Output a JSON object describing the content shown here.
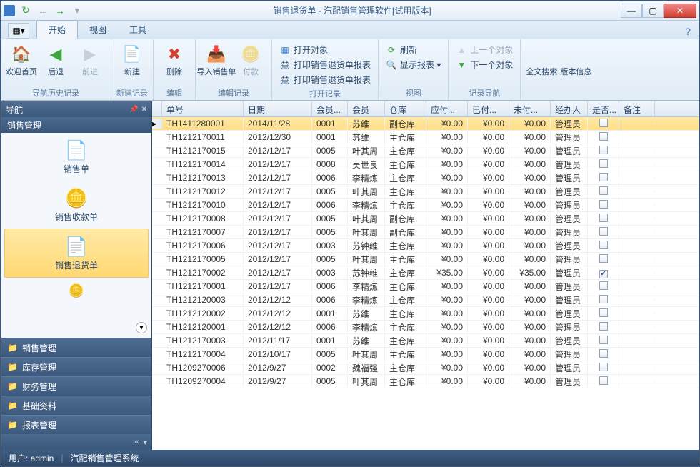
{
  "window": {
    "title": "销售退货单 - 汽配销售管理软件[试用版本]"
  },
  "qat": {
    "refresh": "↻",
    "back": "←",
    "fwd": "→",
    "dd": "▾"
  },
  "tabs": {
    "file": "▦▾",
    "start": "开始",
    "view": "视图",
    "tools": "工具"
  },
  "ribbon": {
    "g1": {
      "label": "导航历史记录",
      "home": "欢迎首页",
      "back": "后退",
      "fwd": "前进"
    },
    "g2": {
      "label": "新建记录",
      "new": "新建"
    },
    "g3": {
      "label": "编辑",
      "del": "删除"
    },
    "g4": {
      "label": "编辑记录",
      "import": "导入销售单",
      "pay": "付款"
    },
    "g5": {
      "label": "打开记录",
      "open": "打开对象",
      "print1": "打印销售退货单报表",
      "print2": "打印销售退货单报表"
    },
    "g6": {
      "label": "视图",
      "refresh": "刷新",
      "show": "显示报表 ▾"
    },
    "g7": {
      "label": "记录导航",
      "prev": "上一个对象",
      "next": "下一个对象"
    },
    "g8": {
      "search": "全文搜索",
      "ver": "版本信息"
    }
  },
  "nav": {
    "title": "导航",
    "section": "销售管理",
    "items": [
      {
        "label": "销售单"
      },
      {
        "label": "销售收款单"
      },
      {
        "label": "销售退货单"
      }
    ],
    "cats": [
      "销售管理",
      "库存管理",
      "财务管理",
      "基础资料",
      "报表管理"
    ]
  },
  "grid": {
    "cols": [
      "单号",
      "日期",
      "会员...",
      "会员",
      "仓库",
      "应付...",
      "已付...",
      "未付...",
      "经办人",
      "是否...",
      "备注"
    ],
    "rows": [
      {
        "no": "TH1411280001",
        "date": "2014/11/28",
        "mid": "0001",
        "mem": "苏维",
        "wh": "副仓库",
        "due": "¥0.00",
        "paid": "¥0.00",
        "un": "¥0.00",
        "op": "管理员",
        "chk": false,
        "sel": true
      },
      {
        "no": "TH1212170011",
        "date": "2012/12/30",
        "mid": "0001",
        "mem": "苏维",
        "wh": "主仓库",
        "due": "¥0.00",
        "paid": "¥0.00",
        "un": "¥0.00",
        "op": "管理员",
        "chk": false
      },
      {
        "no": "TH1212170015",
        "date": "2012/12/17",
        "mid": "0005",
        "mem": "叶其周",
        "wh": "主仓库",
        "due": "¥0.00",
        "paid": "¥0.00",
        "un": "¥0.00",
        "op": "管理员",
        "chk": false
      },
      {
        "no": "TH1212170014",
        "date": "2012/12/17",
        "mid": "0008",
        "mem": "吴世良",
        "wh": "主仓库",
        "due": "¥0.00",
        "paid": "¥0.00",
        "un": "¥0.00",
        "op": "管理员",
        "chk": false
      },
      {
        "no": "TH1212170013",
        "date": "2012/12/17",
        "mid": "0006",
        "mem": "李精炼",
        "wh": "主仓库",
        "due": "¥0.00",
        "paid": "¥0.00",
        "un": "¥0.00",
        "op": "管理员",
        "chk": false
      },
      {
        "no": "TH1212170012",
        "date": "2012/12/17",
        "mid": "0005",
        "mem": "叶其周",
        "wh": "主仓库",
        "due": "¥0.00",
        "paid": "¥0.00",
        "un": "¥0.00",
        "op": "管理员",
        "chk": false
      },
      {
        "no": "TH1212170010",
        "date": "2012/12/17",
        "mid": "0006",
        "mem": "李精炼",
        "wh": "主仓库",
        "due": "¥0.00",
        "paid": "¥0.00",
        "un": "¥0.00",
        "op": "管理员",
        "chk": false
      },
      {
        "no": "TH1212170008",
        "date": "2012/12/17",
        "mid": "0005",
        "mem": "叶其周",
        "wh": "副仓库",
        "due": "¥0.00",
        "paid": "¥0.00",
        "un": "¥0.00",
        "op": "管理员",
        "chk": false
      },
      {
        "no": "TH1212170007",
        "date": "2012/12/17",
        "mid": "0005",
        "mem": "叶其周",
        "wh": "副仓库",
        "due": "¥0.00",
        "paid": "¥0.00",
        "un": "¥0.00",
        "op": "管理员",
        "chk": false
      },
      {
        "no": "TH1212170006",
        "date": "2012/12/17",
        "mid": "0003",
        "mem": "苏钟维",
        "wh": "主仓库",
        "due": "¥0.00",
        "paid": "¥0.00",
        "un": "¥0.00",
        "op": "管理员",
        "chk": false
      },
      {
        "no": "TH1212170005",
        "date": "2012/12/17",
        "mid": "0005",
        "mem": "叶其周",
        "wh": "主仓库",
        "due": "¥0.00",
        "paid": "¥0.00",
        "un": "¥0.00",
        "op": "管理员",
        "chk": false
      },
      {
        "no": "TH1212170002",
        "date": "2012/12/17",
        "mid": "0003",
        "mem": "苏钟维",
        "wh": "主仓库",
        "due": "¥35.00",
        "paid": "¥0.00",
        "un": "¥35.00",
        "op": "管理员",
        "chk": true
      },
      {
        "no": "TH1212170001",
        "date": "2012/12/17",
        "mid": "0006",
        "mem": "李精炼",
        "wh": "主仓库",
        "due": "¥0.00",
        "paid": "¥0.00",
        "un": "¥0.00",
        "op": "管理员",
        "chk": false
      },
      {
        "no": "TH1212120003",
        "date": "2012/12/12",
        "mid": "0006",
        "mem": "李精炼",
        "wh": "主仓库",
        "due": "¥0.00",
        "paid": "¥0.00",
        "un": "¥0.00",
        "op": "管理员",
        "chk": false
      },
      {
        "no": "TH1212120002",
        "date": "2012/12/12",
        "mid": "0001",
        "mem": "苏维",
        "wh": "主仓库",
        "due": "¥0.00",
        "paid": "¥0.00",
        "un": "¥0.00",
        "op": "管理员",
        "chk": false
      },
      {
        "no": "TH1212120001",
        "date": "2012/12/12",
        "mid": "0006",
        "mem": "李精炼",
        "wh": "主仓库",
        "due": "¥0.00",
        "paid": "¥0.00",
        "un": "¥0.00",
        "op": "管理员",
        "chk": false
      },
      {
        "no": "TH1212170003",
        "date": "2012/11/17",
        "mid": "0001",
        "mem": "苏维",
        "wh": "主仓库",
        "due": "¥0.00",
        "paid": "¥0.00",
        "un": "¥0.00",
        "op": "管理员",
        "chk": false
      },
      {
        "no": "TH1212170004",
        "date": "2012/10/17",
        "mid": "0005",
        "mem": "叶其周",
        "wh": "主仓库",
        "due": "¥0.00",
        "paid": "¥0.00",
        "un": "¥0.00",
        "op": "管理员",
        "chk": false
      },
      {
        "no": "TH1209270006",
        "date": "2012/9/27",
        "mid": "0002",
        "mem": "魏福强",
        "wh": "主仓库",
        "due": "¥0.00",
        "paid": "¥0.00",
        "un": "¥0.00",
        "op": "管理员",
        "chk": false
      },
      {
        "no": "TH1209270004",
        "date": "2012/9/27",
        "mid": "0005",
        "mem": "叶其周",
        "wh": "主仓库",
        "due": "¥0.00",
        "paid": "¥0.00",
        "un": "¥0.00",
        "op": "管理员",
        "chk": false
      }
    ]
  },
  "status": {
    "user": "用户: admin",
    "app": "汽配销售管理系统"
  }
}
